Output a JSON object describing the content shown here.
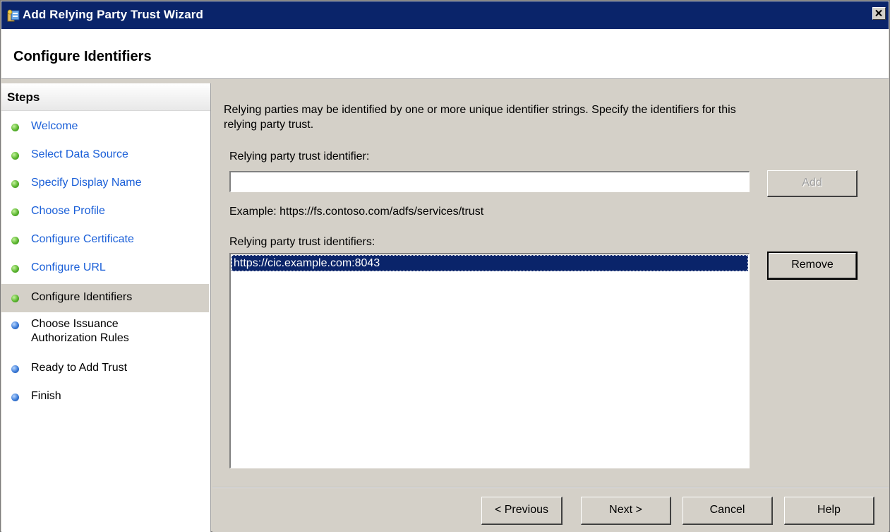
{
  "window": {
    "title": "Add Relying Party Trust Wizard",
    "close_label": "✕"
  },
  "header": {
    "title": "Configure Identifiers"
  },
  "steps": {
    "heading": "Steps",
    "items": [
      {
        "label": "Welcome",
        "status": "complete"
      },
      {
        "label": "Select Data Source",
        "status": "complete"
      },
      {
        "label": "Specify Display Name",
        "status": "complete"
      },
      {
        "label": "Choose Profile",
        "status": "complete"
      },
      {
        "label": "Configure Certificate",
        "status": "complete"
      },
      {
        "label": "Configure URL",
        "status": "complete"
      },
      {
        "label": "Configure Identifiers",
        "status": "current"
      },
      {
        "label": "Choose Issuance",
        "label2": "Authorization Rules",
        "status": "pending"
      },
      {
        "label": "Ready to Add Trust",
        "status": "pending"
      },
      {
        "label": "Finish",
        "status": "pending"
      }
    ]
  },
  "content": {
    "description_line1": "Relying parties may be identified by one or more unique identifier strings. Specify the identifiers for this",
    "description_line2": "relying party trust.",
    "identifier_label": "Relying party trust identifier:",
    "identifier_value": "",
    "add_label": "Add",
    "example_text": "Example: https://fs.contoso.com/adfs/services/trust",
    "identifiers_label": "Relying party trust identifiers:",
    "identifiers": [
      "https://cic.example.com:8043"
    ],
    "remove_label": "Remove"
  },
  "footer": {
    "previous_label": "< Previous",
    "next_label": "Next >",
    "cancel_label": "Cancel",
    "help_label": "Help"
  },
  "colors": {
    "titlebar": "#0a246a",
    "link": "#1a5fd8",
    "selection": "#0a246a"
  }
}
